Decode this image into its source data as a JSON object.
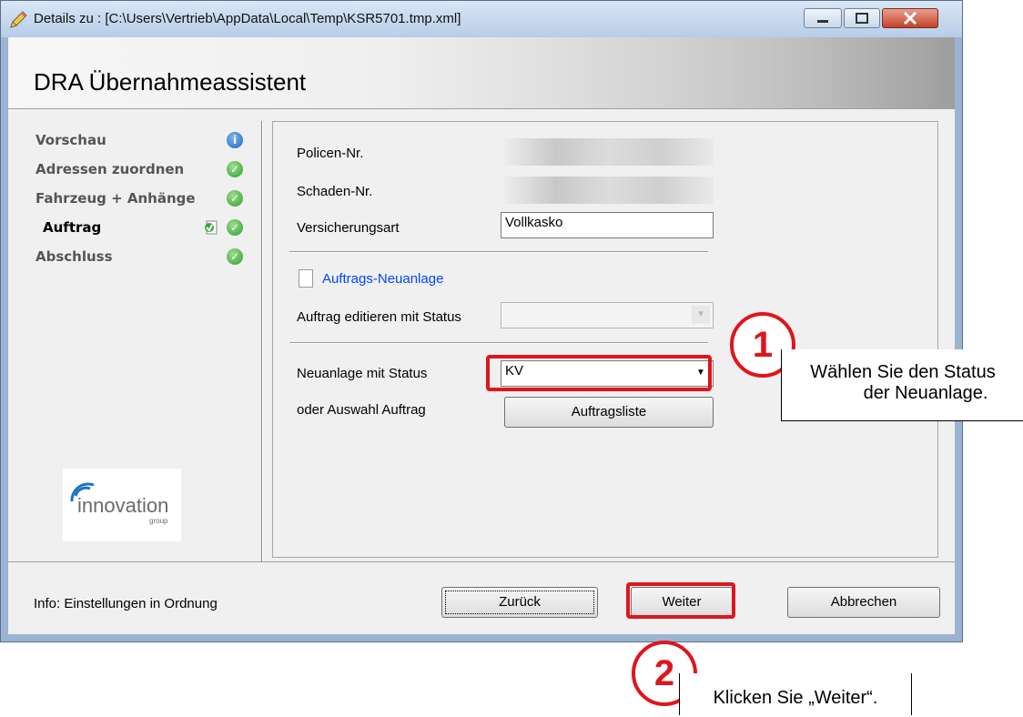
{
  "window": {
    "title": "Details zu : [C:\\Users\\Vertrieb\\AppData\\Local\\Temp\\KSR5701.tmp.xml]",
    "header_title": "DRA Übernahmeassistent"
  },
  "steps": [
    {
      "label": "Vorschau",
      "status": "info-icon"
    },
    {
      "label": "Adressen zuordnen",
      "status": "check-icon"
    },
    {
      "label": "Fahrzeug + Anhänge",
      "status": "check-icon"
    },
    {
      "label": "Auftrag",
      "status": "check-icon",
      "active": true
    },
    {
      "label": "Abschluss",
      "status": "check-icon"
    }
  ],
  "logo": {
    "name": "innovation",
    "sub": "group"
  },
  "form": {
    "policen_label": "Policen-Nr.",
    "schaden_label": "Schaden-Nr.",
    "versicherungsart_label": "Versicherungsart",
    "versicherungsart_value": "Vollkasko",
    "neuanlage_link": "Auftrags-Neuanlage",
    "edit_status_label": "Auftrag editieren mit Status",
    "edit_status_value": "",
    "neuanlage_status_label": "Neuanlage mit Status",
    "neuanlage_status_value": "KV",
    "auswahl_label": "oder Auswahl Auftrag",
    "auftragsliste_button": "Auftragsliste"
  },
  "footer": {
    "info_text": "Info: Einstellungen in Ordnung",
    "back_button": "Zurück",
    "next_button": "Weiter",
    "cancel_button": "Abbrechen"
  },
  "callouts": [
    {
      "number": "1",
      "text_line1": "Wählen Sie den Status",
      "text_line2": "der Neuanlage."
    },
    {
      "number": "2",
      "text_line1": "Klicken Sie „Weiter“."
    }
  ],
  "colors": {
    "highlight": "#e0151b",
    "link": "#0046ff",
    "check": "#2f9b2a",
    "info": "#1f63c4"
  }
}
